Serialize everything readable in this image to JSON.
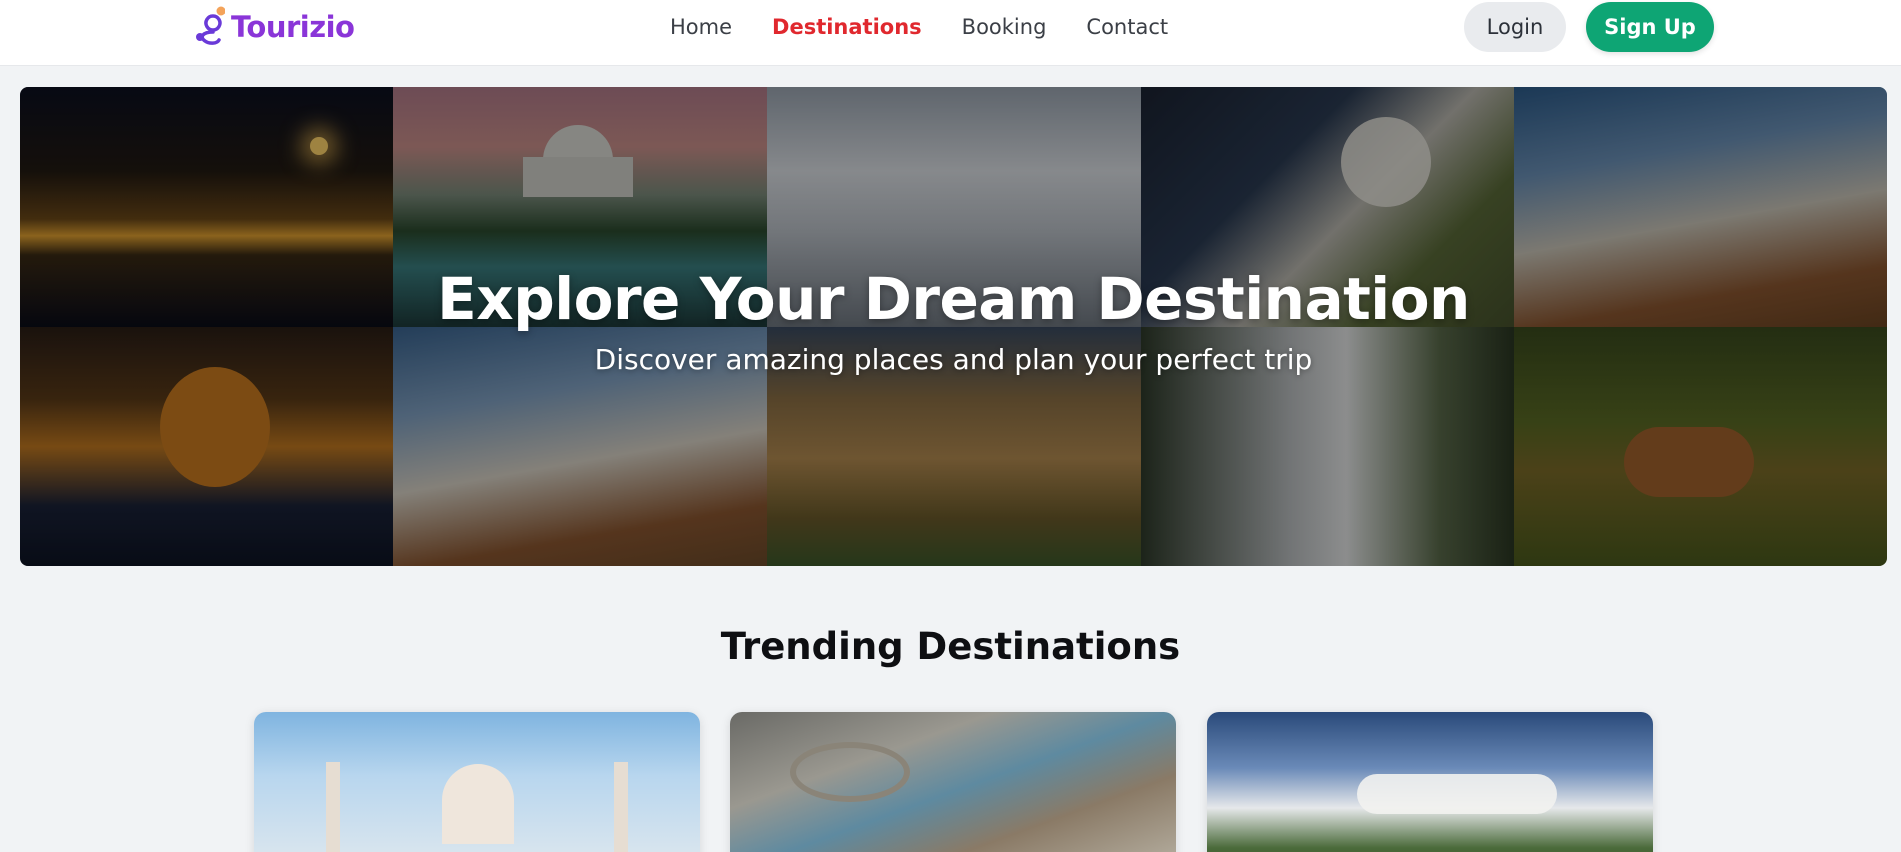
{
  "brand": {
    "name": "Tourizio",
    "logo_color": "#8a35d8",
    "logo_accent": "#f4a35a"
  },
  "nav": {
    "items": [
      {
        "label": "Home",
        "active": false
      },
      {
        "label": "Destinations",
        "active": true
      },
      {
        "label": "Booking",
        "active": false
      },
      {
        "label": "Contact",
        "active": false
      }
    ],
    "active_color": "#e0282e"
  },
  "auth": {
    "login_label": "Login",
    "signup_label": "Sign Up",
    "signup_color": "#0ea574"
  },
  "hero": {
    "title": "Explore Your Dream Destination",
    "subtitle": "Discover amazing places and plan your perfect trip",
    "collage": [
      "night-city-ghats-image",
      "taj-mahal-pool-image",
      "snowy-village-image",
      "steam-train-image",
      "beach-loungers-image",
      "tiger-in-water-image",
      "beach-chairs-image",
      "fort-palace-image",
      "waterfall-image",
      "spotted-deer-image"
    ]
  },
  "trending": {
    "title": "Trending Destinations",
    "cards": [
      {
        "image": "taj-mahal-image"
      },
      {
        "image": "quarry-landscape-image"
      },
      {
        "image": "mountain-clouds-image"
      }
    ]
  }
}
